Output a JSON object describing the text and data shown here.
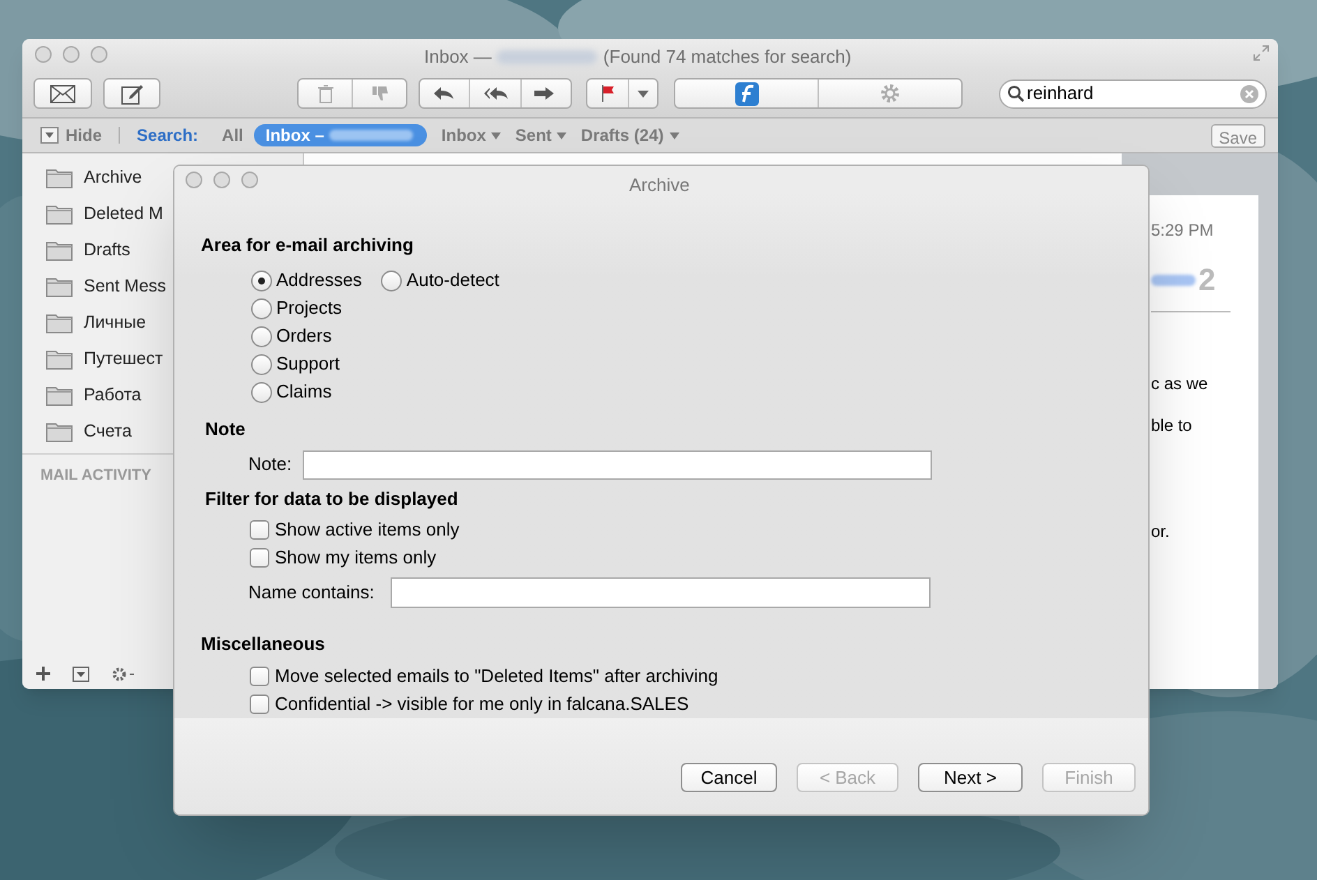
{
  "mail_window": {
    "title": "Inbox —",
    "title_suffix": "(Found 74 matches for search)",
    "search": {
      "value": "reinhard"
    }
  },
  "favorites_bar": {
    "hide": "Hide",
    "search_label": "Search:",
    "scopes": [
      {
        "label": "All",
        "selected": false
      },
      {
        "label": "Inbox –",
        "selected": true
      }
    ],
    "mailboxes": [
      "Inbox",
      "Sent",
      "Drafts (24)"
    ],
    "save": "Save"
  },
  "sidebar": {
    "folders": [
      "Archive",
      "Deleted M",
      "Drafts",
      "Sent Mess",
      "Личные",
      "Путешест",
      "Работа",
      "Счета"
    ],
    "section": "MAIL ACTIVITY"
  },
  "message": {
    "time": "5:29 PM",
    "count": "2",
    "lines": [
      "c as we",
      "ble to",
      "or."
    ]
  },
  "dialog": {
    "title": "Archive",
    "area": {
      "heading": "Area for e-mail archiving",
      "column_1": [
        {
          "label": "Addresses",
          "selected": true
        },
        {
          "label": "Projects",
          "selected": false
        },
        {
          "label": "Orders",
          "selected": false
        },
        {
          "label": "Support",
          "selected": false
        },
        {
          "label": "Claims",
          "selected": false
        }
      ],
      "column_2": [
        {
          "label": "Auto-detect",
          "selected": false
        }
      ]
    },
    "note": {
      "heading": "Note",
      "label": "Note:"
    },
    "filter": {
      "heading": "Filter for data to be displayed",
      "checkboxes": [
        {
          "label": "Show active items only",
          "checked": false
        },
        {
          "label": "Show my items only",
          "checked": false
        }
      ],
      "name_label": "Name contains:"
    },
    "misc": {
      "heading": "Miscellaneous",
      "checkboxes": [
        {
          "label": "Move selected emails to \"Deleted Items\" after archiving",
          "checked": false
        },
        {
          "label": "Confidential -> visible for me only in falcana.SALES",
          "checked": false
        }
      ]
    },
    "buttons": [
      {
        "label": "Cancel",
        "disabled": false
      },
      {
        "label": "< Back",
        "disabled": true
      },
      {
        "label": "Next >",
        "disabled": false
      },
      {
        "label": "Finish",
        "disabled": true
      }
    ]
  }
}
